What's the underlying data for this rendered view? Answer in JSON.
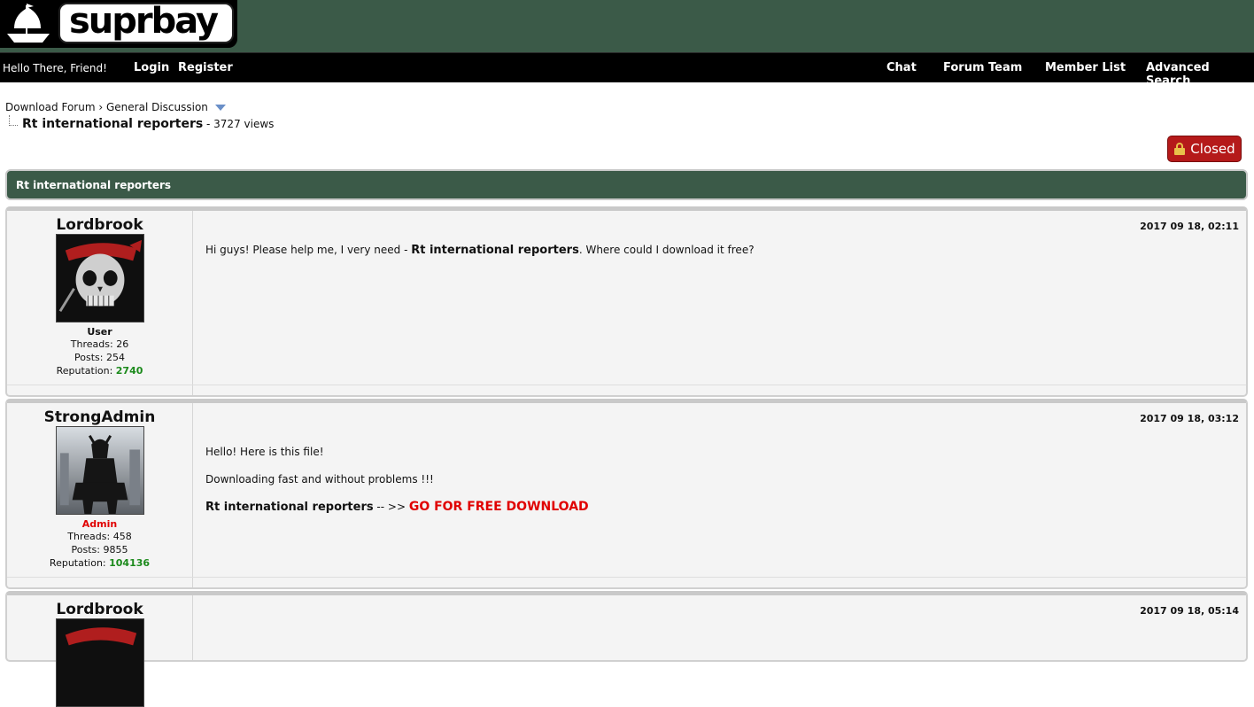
{
  "site": {
    "logo_text": "suprbay"
  },
  "nav": {
    "greeting": "Hello There, Friend!",
    "login": "Login",
    "register": "Register",
    "chat": "Chat",
    "forum_team": "Forum Team",
    "member_list": "Member List",
    "advanced_search": "Advanced Search"
  },
  "breadcrumb": {
    "items": [
      "Download Forum",
      "General Discussion"
    ],
    "separator": "›",
    "thread_title": "Rt international reporters",
    "views": "- 3727 views"
  },
  "closed_button": "Closed",
  "thread_banner": "Rt international reporters",
  "posts": [
    {
      "author": "Lordbrook",
      "role": "User",
      "threads": "Threads: 26",
      "posts": "Posts: 254",
      "reputation_label": "Reputation:",
      "reputation": "2740",
      "date": "2017 09 18, 02:11",
      "body_prefix": "Hi guys! Please help me, I very need - ",
      "body_bold": "Rt international reporters",
      "body_suffix": ". Where could I download it free?"
    },
    {
      "author": "StrongAdmin",
      "role": "Admin",
      "threads": "Threads: 458",
      "posts": "Posts: 9855",
      "reputation_label": "Reputation:",
      "reputation": "104136",
      "date": "2017 09 18, 03:12",
      "line1": "Hello! Here is this file!",
      "line2": "Downloading fast and without problems !!!",
      "link_title": "Rt international reporters",
      "link_arrow": " -- >> ",
      "link_text": "GO FOR FREE DOWNLOAD"
    },
    {
      "author": "Lordbrook",
      "date": "2017 09 18, 05:14"
    }
  ],
  "colors": {
    "header_bg": "#3b5a48",
    "navbar_bg": "#000000",
    "closed_bg": "#b51a1a",
    "reputation": "#1c8a1c",
    "admin": "#e00000",
    "download_link": "#e00000"
  }
}
